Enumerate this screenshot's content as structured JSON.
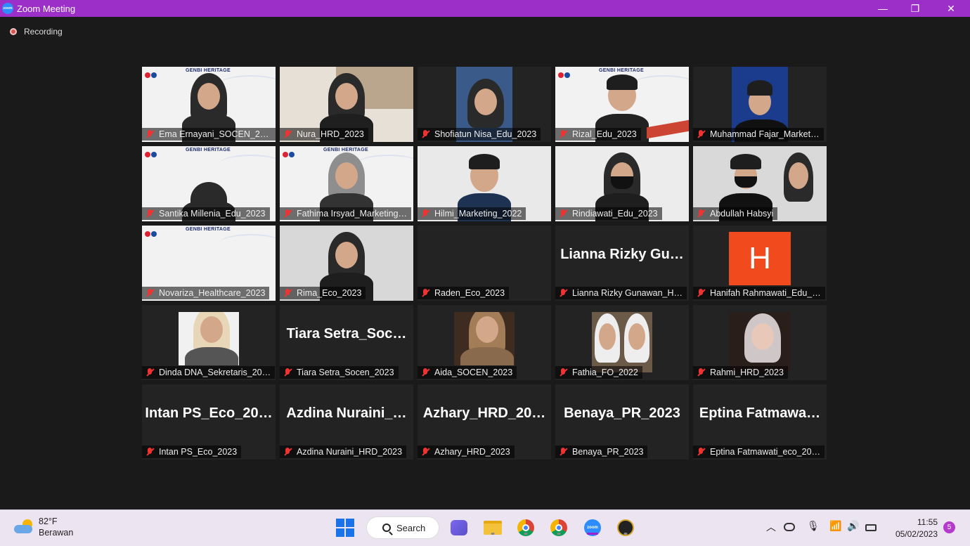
{
  "window": {
    "title": "Zoom Meeting",
    "minimize": "—",
    "restore": "❐",
    "close": "✕"
  },
  "recording": {
    "label": "Recording"
  },
  "banner_text": "GENBI HERITAGE",
  "participants": [
    {
      "name": "Ema Ernayani_SOCEN_20…"
    },
    {
      "name": "Nura_HRD_2023"
    },
    {
      "name": "Shofiatun Nisa_Edu_2023"
    },
    {
      "name": "Rizal_Edu_2023"
    },
    {
      "name": "Muhammad Fajar_Market…"
    },
    {
      "name": "Santika Millenia_Edu_2023"
    },
    {
      "name": "Fathima Irsyad_Marketing…"
    },
    {
      "name": "Hilmi_Marketing_2022"
    },
    {
      "name": "Rindiawati_Edu_2023"
    },
    {
      "name": "Abdullah Habsyi"
    },
    {
      "name": "Novariza_Healthcare_2023"
    },
    {
      "name": "Rima_Eco_2023"
    },
    {
      "name": "Raden_Eco_2023"
    },
    {
      "name": "Lianna Rizky Gunawan_H…",
      "big": "Lianna Rizky Gu…"
    },
    {
      "name": "Hanifah Rahmawati_Edu_…",
      "initial": "H"
    },
    {
      "name": "Dinda DNA_Sekretaris_20…"
    },
    {
      "name": "Tiara Setra_Socen_2023",
      "big": "Tiara Setra_Soc…"
    },
    {
      "name": "Aida_SOCEN_2023"
    },
    {
      "name": "Fathia_FO_2022"
    },
    {
      "name": "Rahmi_HRD_2023"
    },
    {
      "name": "Intan PS_Eco_2023",
      "big": "Intan PS_Eco_20…"
    },
    {
      "name": "Azdina Nuraini_HRD_2023",
      "big": "Azdina Nuraini_…"
    },
    {
      "name": "Azhary_HRD_2023",
      "big": "Azhary_HRD_20…"
    },
    {
      "name": "Benaya_PR_2023",
      "big": "Benaya_PR_2023"
    },
    {
      "name": "Eptina Fatmawati_eco_20…",
      "big": "Eptina Fatmawa…"
    }
  ],
  "taskbar": {
    "weather_temp": "82°F",
    "weather_desc": "Berawan",
    "search_label": "Search",
    "time": "11:55",
    "date": "05/02/2023",
    "notification_count": "5"
  },
  "colors": {
    "titlebar": "#9b2fc7",
    "muted_mic": "#e33",
    "avatar_h": "#f04a1d"
  }
}
